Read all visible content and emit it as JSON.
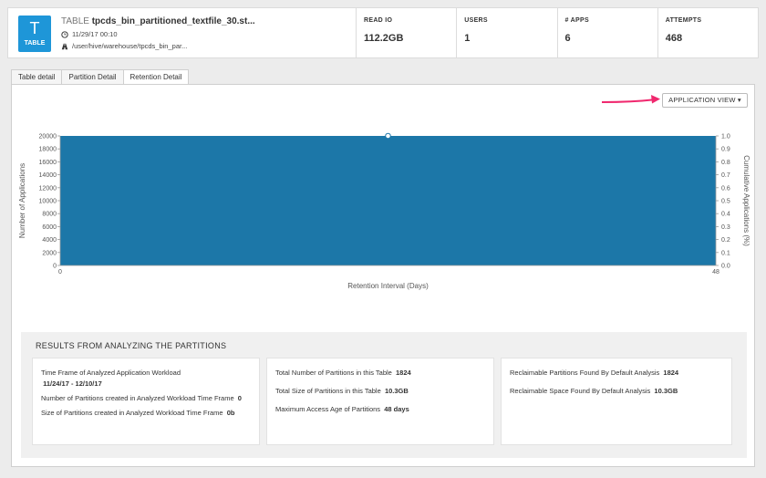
{
  "header": {
    "badge_letter": "T",
    "badge_word": "TABLE",
    "kind": "TABLE",
    "name": "tpcds_bin_partitioned_textfile_30.st...",
    "timestamp": "11/29/17 00:10",
    "path": "/user/hive/warehouse/tpcds_bin_par...",
    "stats": [
      {
        "label": "READ IO",
        "value": "112.2GB"
      },
      {
        "label": "USERS",
        "value": "1"
      },
      {
        "label": "# APPS",
        "value": "6"
      },
      {
        "label": "ATTEMPTS",
        "value": "468"
      }
    ]
  },
  "tabs": [
    {
      "label": "Table detail",
      "active": false
    },
    {
      "label": "Partition Detail",
      "active": false
    },
    {
      "label": "Retention Detail",
      "active": true
    }
  ],
  "view_button": "APPLICATION VIEW ▾",
  "chart_data": {
    "type": "area",
    "xlabel": "Retention Interval (Days)",
    "ylabel": "Number of Applications",
    "y2label": "Cumulative Applications (%)",
    "x": [
      0,
      48
    ],
    "series": [
      {
        "values": [
          20000,
          20000
        ]
      }
    ],
    "xlim": [
      0,
      48
    ],
    "ylim": [
      0,
      20000
    ],
    "y2lim": [
      0,
      1.0
    ],
    "xticks": [
      "0",
      "48"
    ],
    "yticks": [
      "0",
      "2000",
      "4000",
      "6000",
      "8000",
      "10000",
      "12000",
      "14000",
      "16000",
      "18000",
      "20000"
    ],
    "y2ticks": [
      "0.0",
      "0.1",
      "0.2",
      "0.3",
      "0.4",
      "0.5",
      "0.6",
      "0.7",
      "0.8",
      "0.9",
      "1.0"
    ],
    "marker_x": 24,
    "marker_y": 20000,
    "fill_color": "#1c77a8"
  },
  "results": {
    "title": "RESULTS FROM ANALYZING THE PARTITIONS",
    "card1": {
      "time_frame_label": "Time Frame of Analyzed Application Workload",
      "time_frame_value": "11/24/17 - 12/10/17",
      "partitions_created_label": "Number of Partitions created in Analyzed Workload Time Frame",
      "partitions_created_value": "0",
      "size_created_label": "Size of Partitions created in Analyzed Workload Time Frame",
      "size_created_value": "0b"
    },
    "card2": {
      "total_partitions_label": "Total Number of Partitions in this Table",
      "total_partitions_value": "1824",
      "total_size_label": "Total Size of Partitions in this Table",
      "total_size_value": "10.3GB",
      "max_age_label": "Maximum Access Age of Partitions",
      "max_age_value": "48 days"
    },
    "card3": {
      "reclaimable_partitions_label": "Reclaimable Partitions Found By Default Analysis",
      "reclaimable_partitions_value": "1824",
      "reclaimable_space_label": "Reclaimable Space Found By Default Analysis",
      "reclaimable_space_value": "10.3GB"
    }
  }
}
